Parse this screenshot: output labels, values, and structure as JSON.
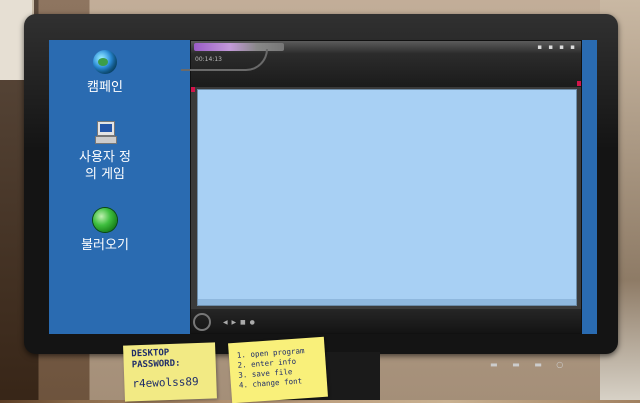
{
  "desktop": {
    "icons": [
      {
        "label": "캠페인",
        "icon": "globe-icon"
      },
      {
        "label": "사용자 정의 게임",
        "icon": "computer-icon"
      },
      {
        "label": "불러오기",
        "icon": "green-orb-icon"
      }
    ]
  },
  "app_window": {
    "title_bar_glyphs": "▪ ▪ ▪ ▪",
    "toolbar_time": "00:14:13",
    "control_glyphs": "◀ ▶ ■ ●"
  },
  "sticky_notes": {
    "left": {
      "lines": [
        "DESKTOP",
        "PASSWORD:"
      ],
      "password": "r4ewolss89"
    },
    "right": {
      "lines": [
        "1. open program",
        "2. enter info",
        "3. save file",
        "4. change font"
      ]
    }
  },
  "monitor": {
    "buttons_glyphs": "▬ ▬ ▬ ○"
  },
  "colors": {
    "desktop_bg": "#2a6bb1",
    "viewport": "#a8d0f4",
    "accent": "#d2144a"
  }
}
